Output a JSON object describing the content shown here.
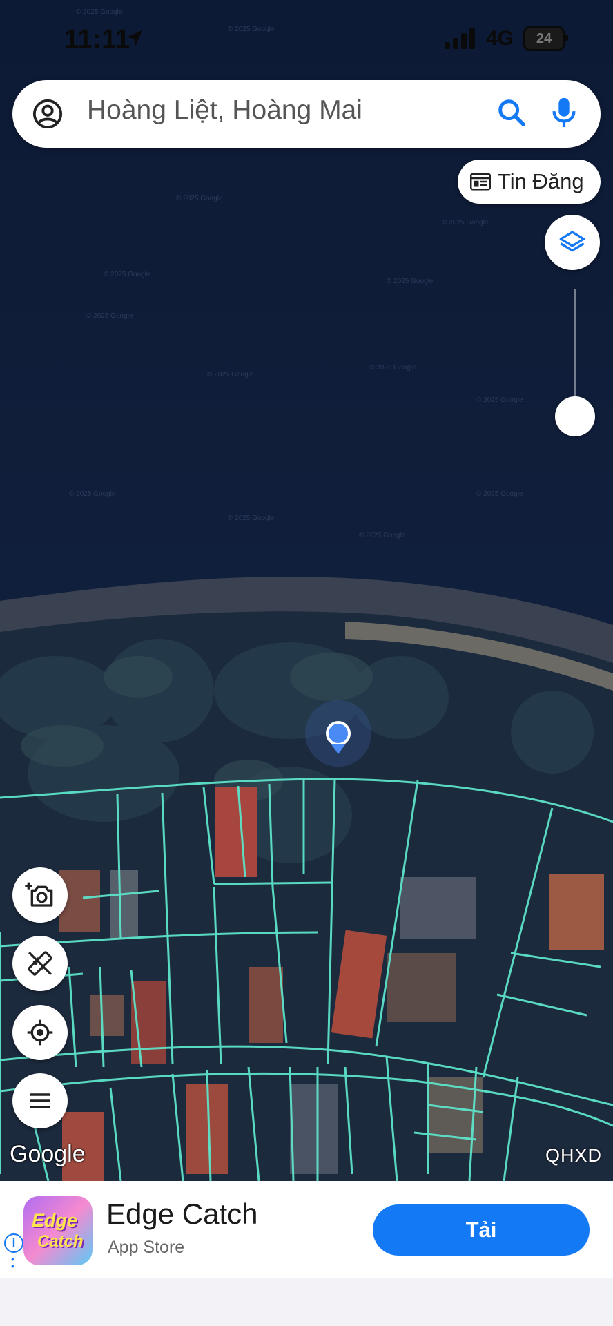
{
  "status_bar": {
    "time": "11:11",
    "network": "4G",
    "battery": "24"
  },
  "search": {
    "query": "Hoàng Liệt, Hoàng Mai"
  },
  "chip": {
    "label": "Tin Đăng"
  },
  "map": {
    "attribution": "Google",
    "layer_label": "QHXD"
  },
  "icons": [
    "account-circle-icon",
    "search-icon",
    "mic-icon",
    "listing-icon",
    "layers-icon",
    "add-photo-icon",
    "measure-icon",
    "my-location-icon",
    "menu-icon",
    "location-arrow-icon",
    "info-icon"
  ],
  "ad": {
    "app_name": "Edge Catch",
    "store": "App Store",
    "cta_label": "Tải",
    "icon_text_1": "Edge",
    "icon_text_2": "Catch"
  },
  "colors": {
    "accent": "#1479f5",
    "parcel_lines": "#5de3c9",
    "water": "#0f1d3a",
    "location_dot": "#4a8af4"
  }
}
